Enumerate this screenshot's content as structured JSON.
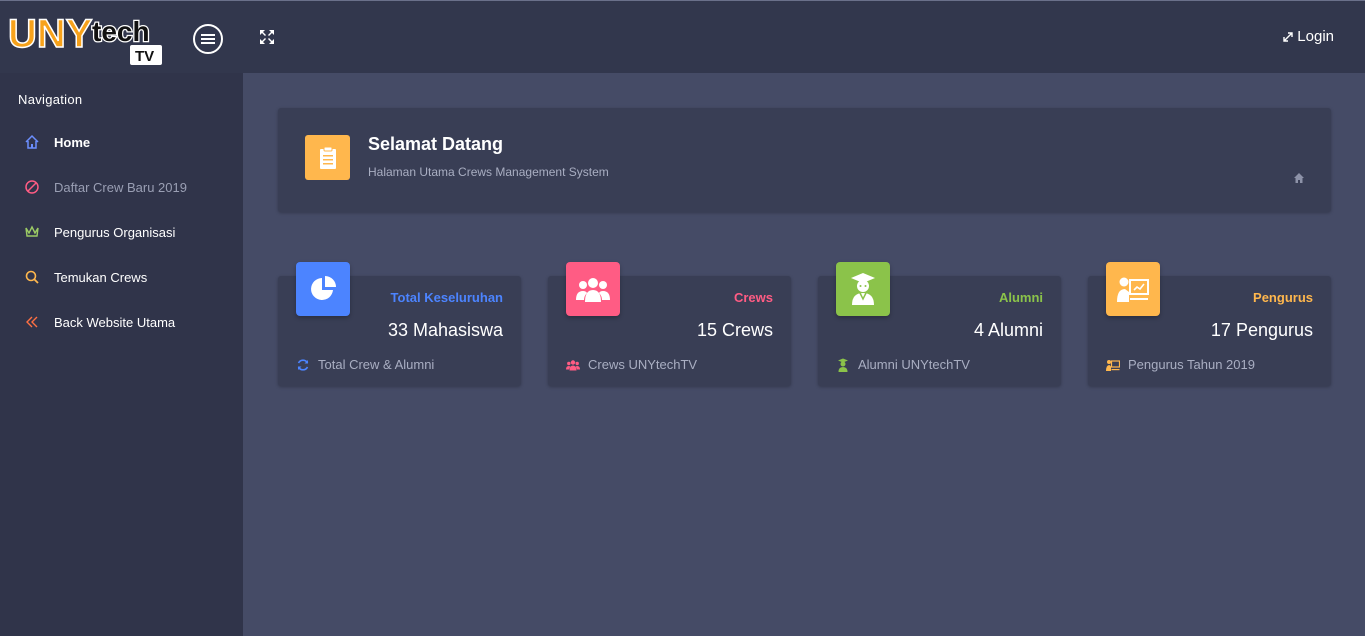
{
  "header": {
    "logo_text_uny": "UNY",
    "logo_text_tech": "tech",
    "logo_text_tv": "TV",
    "login_label": "Login"
  },
  "sidebar": {
    "title": "Navigation",
    "items": [
      {
        "label": "Home",
        "icon": "home-icon",
        "color": "#6c8fff"
      },
      {
        "label": "Daftar Crew Baru 2019",
        "icon": "ban-icon",
        "color": "#ff5c84"
      },
      {
        "label": "Pengurus Organisasi",
        "icon": "crown-icon",
        "color": "#9ccc65"
      },
      {
        "label": "Temukan Crews",
        "icon": "search-icon",
        "color": "#ffb74d"
      },
      {
        "label": "Back Website Utama",
        "icon": "double-chevron-left-icon",
        "color": "#ff7043"
      }
    ]
  },
  "welcome": {
    "title": "Selamat Datang",
    "subtitle": "Halaman Utama Crews Management System",
    "icon": "clipboard-icon"
  },
  "cards": [
    {
      "label": "Total Keseluruhan",
      "value": "33 Mahasiswa",
      "footer": "Total Crew & Alumni",
      "color": "#4c84ff",
      "icon": "pie-chart-icon",
      "footer_icon": "refresh-icon"
    },
    {
      "label": "Crews",
      "value": "15 Crews",
      "footer": "Crews UNYtechTV",
      "color": "#ff5c84",
      "icon": "users-icon",
      "footer_icon": "users-icon"
    },
    {
      "label": "Alumni",
      "value": "4 Alumni",
      "footer": "Alumni UNYtechTV",
      "color": "#8bc34a",
      "icon": "graduate-icon",
      "footer_icon": "graduate-icon"
    },
    {
      "label": "Pengurus",
      "value": "17 Pengurus",
      "footer": "Pengurus Tahun 2019",
      "color": "#ffb74d",
      "icon": "presenter-icon",
      "footer_icon": "presenter-icon"
    }
  ]
}
